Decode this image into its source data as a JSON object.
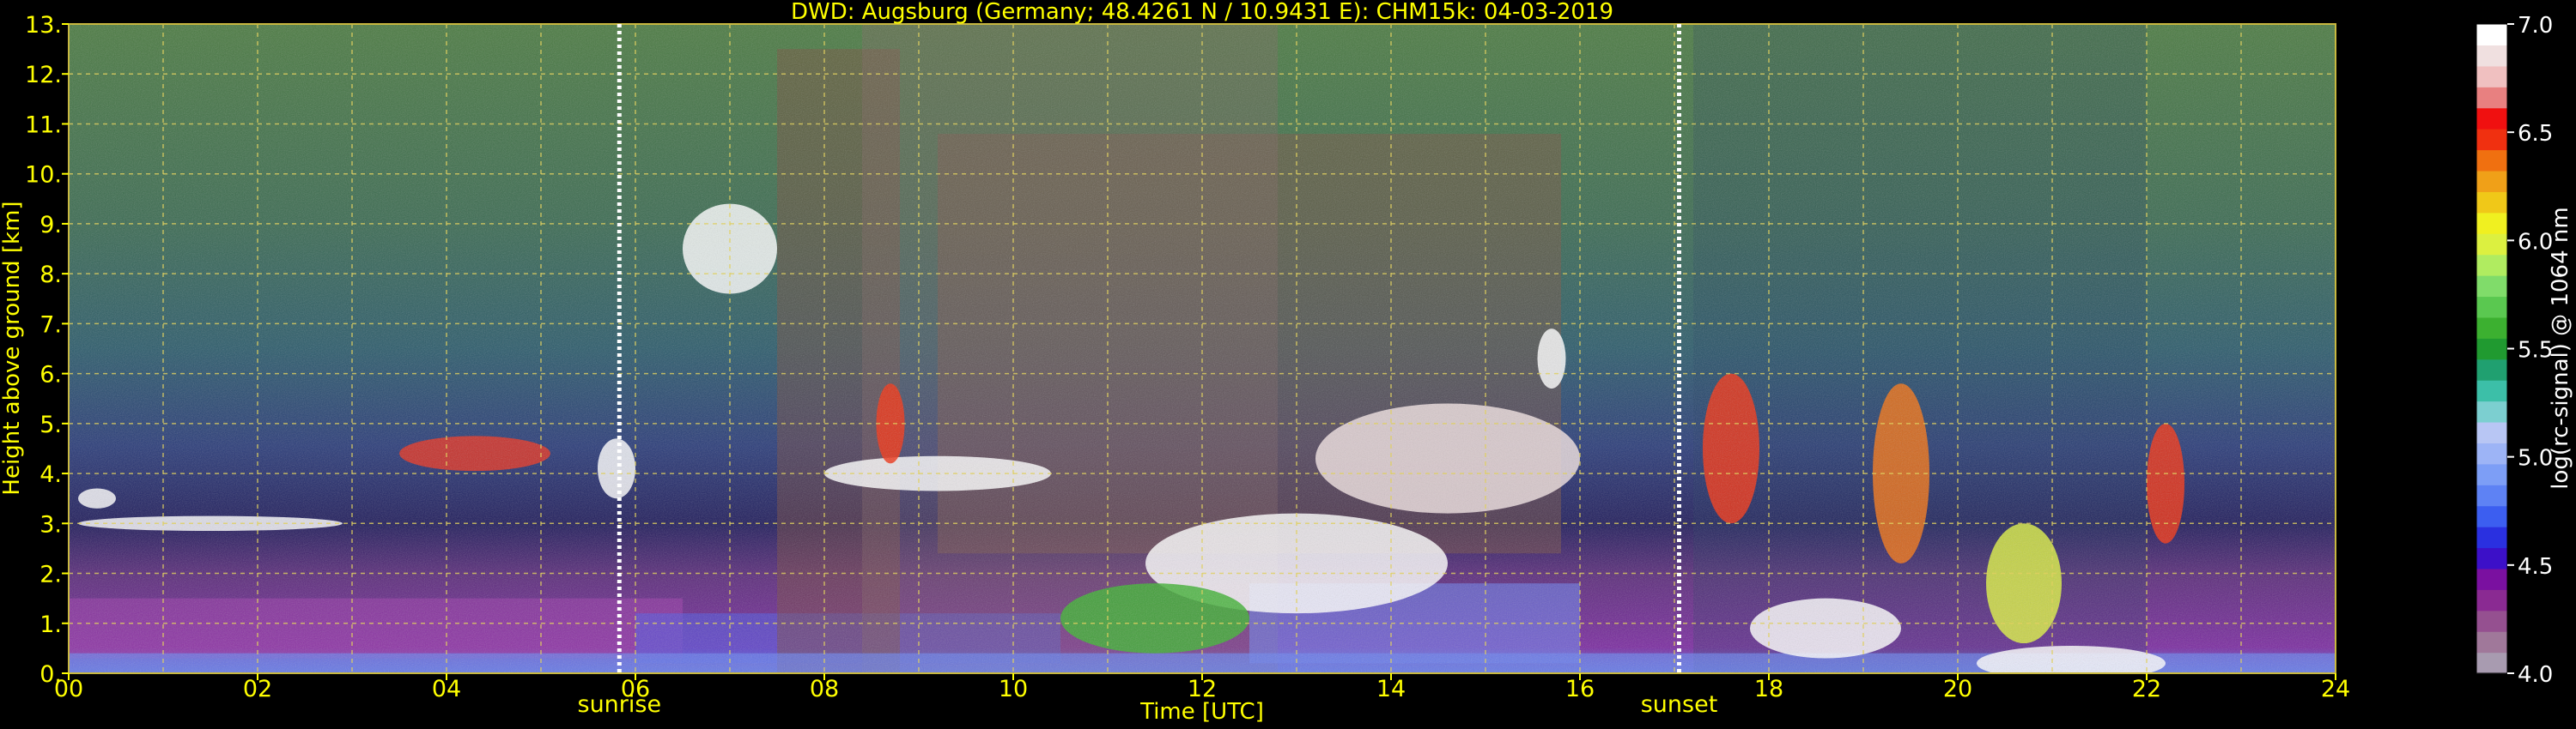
{
  "chart_data": {
    "type": "heatmap",
    "title": "DWD: Augsburg (Germany; 48.4261 N / 10.9431 E):    CHM15k: 04-03-2019",
    "xlabel": "Time [UTC]",
    "ylabel": "Height above ground [km]",
    "xlim": [
      0,
      24
    ],
    "ylim": [
      0,
      13
    ],
    "xticks": [
      "00",
      "02",
      "04",
      "06",
      "08",
      "10",
      "12",
      "14",
      "16",
      "18",
      "20",
      "22",
      "24"
    ],
    "yticks": [
      "0.",
      "1.",
      "2.",
      "3.",
      "4.",
      "5.",
      "6.",
      "7.",
      "8.",
      "9.",
      "10.",
      "11.",
      "12.",
      "13."
    ],
    "grid": true,
    "markers": [
      {
        "label": "sunrise",
        "time": 5.83
      },
      {
        "label": "sunset",
        "time": 17.05
      }
    ],
    "colorbar": {
      "label": "log(rc-signal) @ 1064 nm",
      "range": [
        4.0,
        7.0
      ],
      "ticks": [
        "4.0",
        "4.5",
        "5.0",
        "5.5",
        "6.0",
        "6.5",
        "7.0"
      ],
      "colors": [
        "#a89bb0",
        "#a0789a",
        "#955090",
        "#8a2a92",
        "#7a10a0",
        "#3c10c8",
        "#2a30e0",
        "#3c5ef0",
        "#5e82f4",
        "#7d9ef6",
        "#9db4f6",
        "#b8c6f4",
        "#7ccfd0",
        "#3cbfa8",
        "#20a070",
        "#209a30",
        "#3cb030",
        "#5ac850",
        "#80dc6a",
        "#b0ec60",
        "#dcf040",
        "#f0f020",
        "#f0c818",
        "#f0a018",
        "#f07010",
        "#f03010",
        "#f01010",
        "#e88080",
        "#f0c0c0",
        "#f0e0e0",
        "#ffffff"
      ]
    }
  },
  "colors": {
    "text": "#ffff00",
    "grid": "#e0d060",
    "background": "#000000"
  }
}
